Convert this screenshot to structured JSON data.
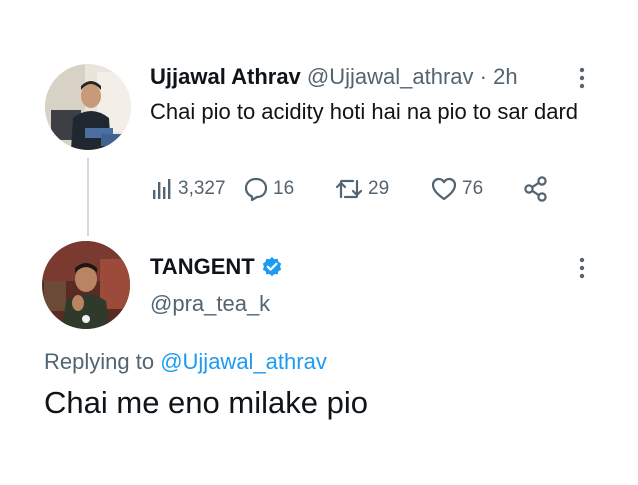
{
  "parent_tweet": {
    "author_name": "Ujjawal Athrav",
    "handle": "@Ujjawal_athrav",
    "separator": "·",
    "time": "2h",
    "text": "Chai pio to acidity hoti hai na pio to sar dard",
    "views": "3,327",
    "replies": "16",
    "retweets": "29",
    "likes": "76"
  },
  "reply_tweet": {
    "author_name": "TANGENT",
    "handle": "@pra_tea_k",
    "replying_prefix": "Replying to",
    "replying_to": "@Ujjawal_athrav",
    "text": "Chai me eno milake pio"
  },
  "colors": {
    "text_primary": "#0f1419",
    "text_secondary": "#536471",
    "accent": "#1d9bf0",
    "thread_line": "#cfd9de"
  },
  "icons": [
    "views-icon",
    "reply-icon",
    "retweet-icon",
    "like-icon",
    "share-icon",
    "more-icon",
    "verified-badge-icon"
  ]
}
